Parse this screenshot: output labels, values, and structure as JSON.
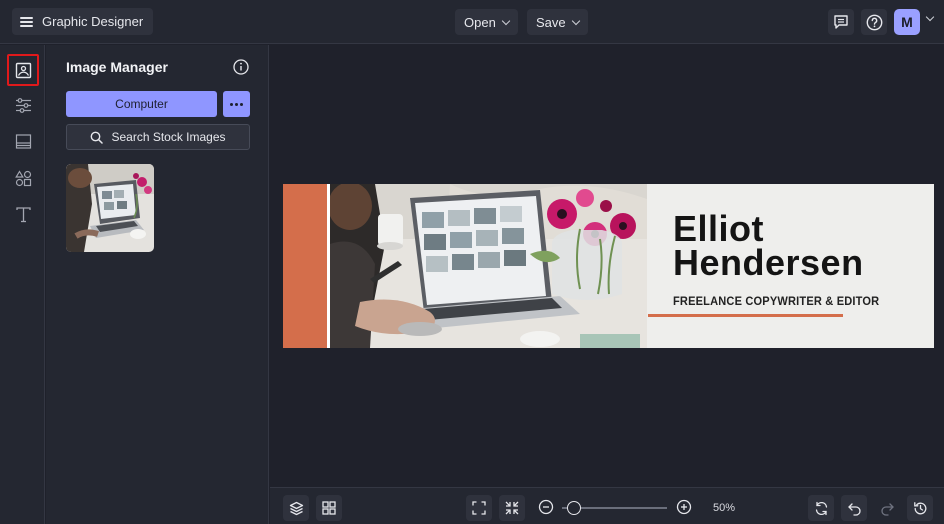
{
  "header": {
    "app_title": "Graphic Designer",
    "open_label": "Open",
    "save_label": "Save",
    "avatar_initial": "M"
  },
  "panel": {
    "title": "Image Manager",
    "computer_label": "Computer",
    "search_label": "Search Stock Images"
  },
  "banner": {
    "name_line1": "Elliot",
    "name_line2": "Hendersen",
    "subtitle": "FREELANCE COPYWRITER & EDITOR"
  },
  "bottombar": {
    "zoom_level": "50%"
  },
  "colors": {
    "accent": "#8f96ff",
    "banner_orange": "#d46e4b",
    "highlight": "#e0191b"
  }
}
